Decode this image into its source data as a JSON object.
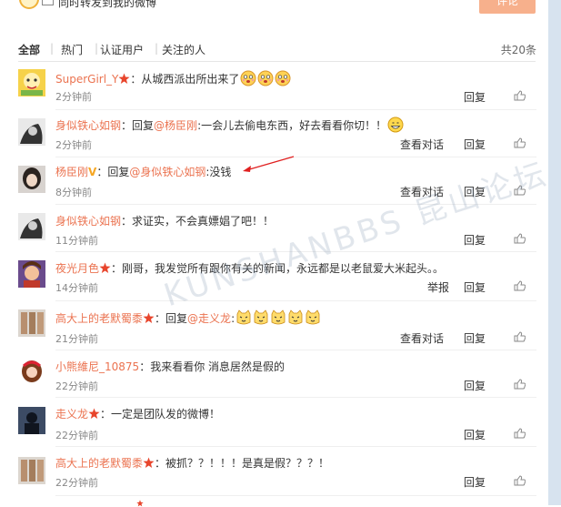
{
  "composer": {
    "share_label": "同时转发到我的微博",
    "submit_label": "评论"
  },
  "filters": {
    "items": [
      "全部",
      "热门",
      "认证用户",
      "关注的人"
    ],
    "total": "共20条"
  },
  "actions": {
    "reply": "回复",
    "view_conversation": "查看对话",
    "report": "举报"
  },
  "comments": [
    {
      "name": "SuperGirl_Y",
      "text": "从城西派出所出来了",
      "time": "2分钟前"
    },
    {
      "name": "身似铁心如钢",
      "prefix": "回复",
      "mention": "@杨臣刚",
      "text": ":一会儿去偷电东西，好去看看你切！！",
      "time": "2分钟前"
    },
    {
      "name": "杨臣刚",
      "prefix": "回复",
      "mention": "@身似铁心如钢",
      "text": ":没钱",
      "time": "8分钟前"
    },
    {
      "name": "身似铁心如钢",
      "text": "求证实，不会真嫖娼了吧！！",
      "time": "11分钟前"
    },
    {
      "name": "夜光月色",
      "text": "刚哥，我发觉所有跟你有关的新闻，永远都是以老鼠爱大米起头。。",
      "time": "14分钟前"
    },
    {
      "name": "高大上的老默蜀黍",
      "prefix": "回复",
      "mention": "@走义龙",
      "text": ":",
      "time": "21分钟前"
    },
    {
      "name": "小熊維尼_10875",
      "text": "我来看看你 消息居然是假的",
      "time": "22分钟前"
    },
    {
      "name": "走义龙",
      "text": "一定是团队发的微博！",
      "time": "22分钟前"
    },
    {
      "name": "高大上的老默蜀黍",
      "text": "被抓？？！！！是真是假？？？！",
      "time": "22分钟前"
    }
  ],
  "watermark": "KUNSHANBBS 昆山论坛",
  "colors": {
    "name": "#eb7350",
    "link": "#eb7350",
    "badge": "#e8452c",
    "vip": "#f5a623"
  }
}
